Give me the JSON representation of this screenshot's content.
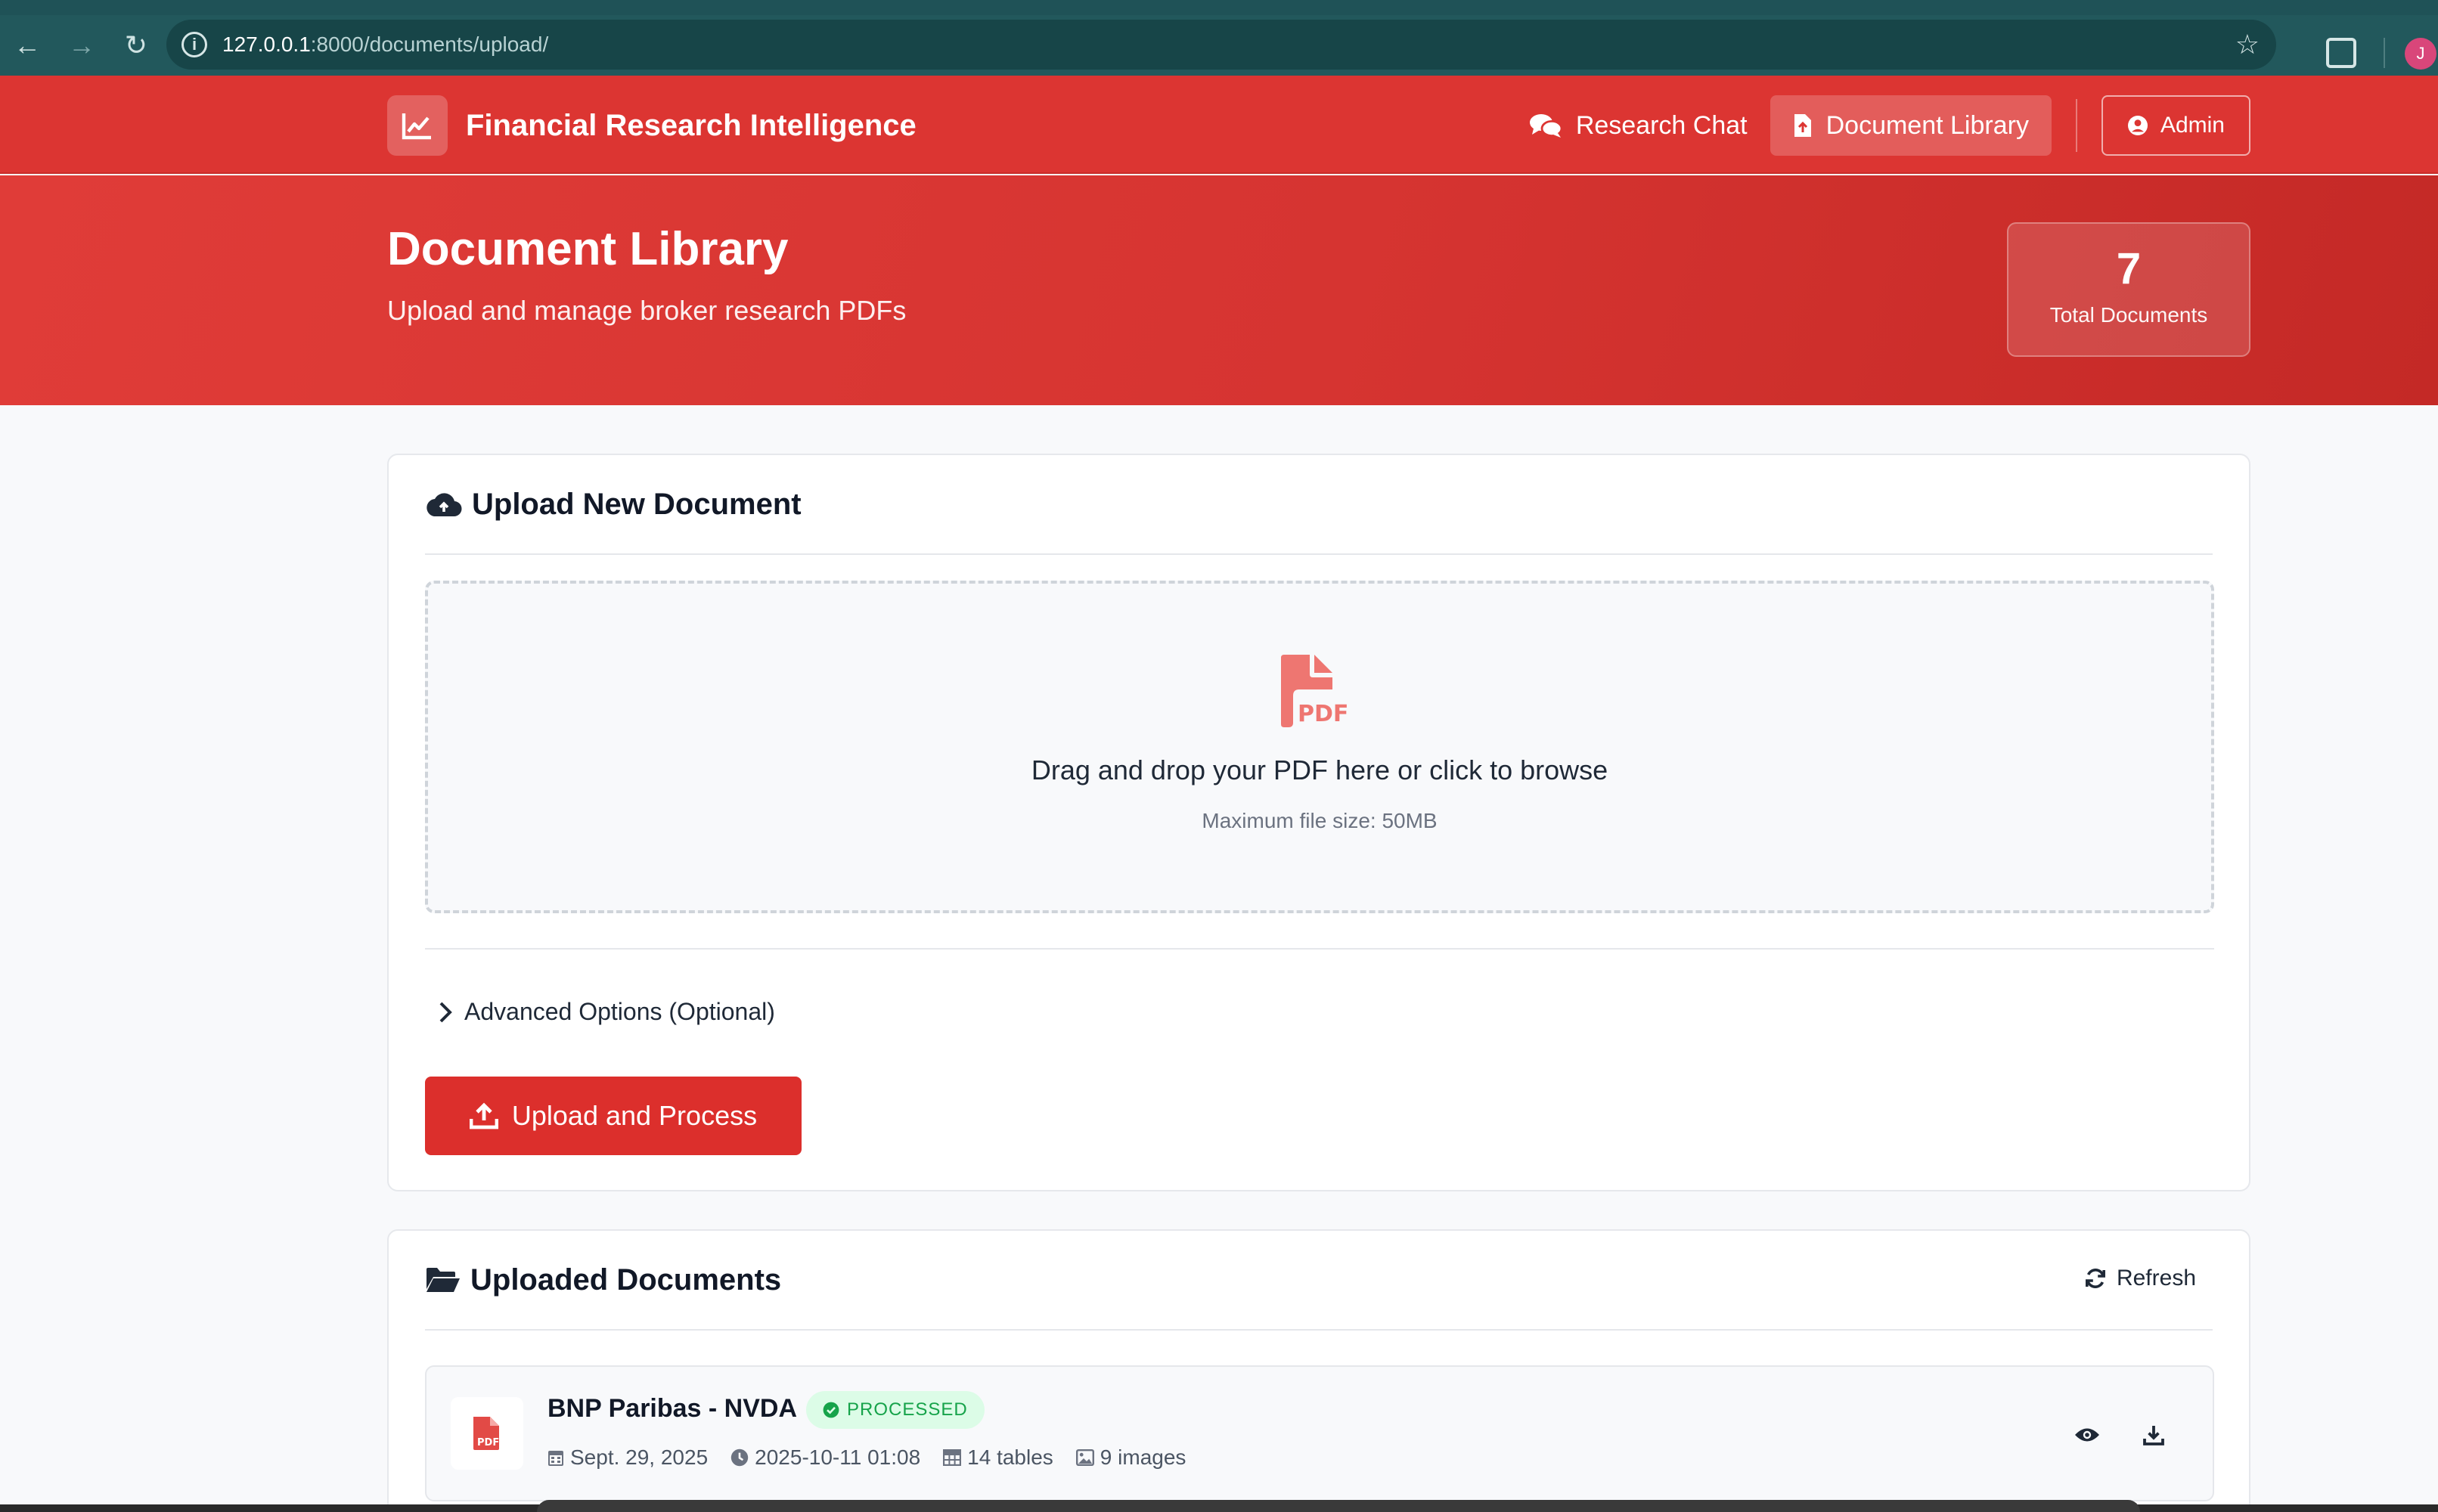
{
  "browser": {
    "url_host": "127.0.0.1",
    "url_path": ":8000/documents/upload/",
    "profile_initial": "J"
  },
  "header": {
    "brand": "Financial Research Intelligence",
    "nav": {
      "research_chat": "Research Chat",
      "document_library": "Document Library",
      "admin": "Admin"
    }
  },
  "hero": {
    "title": "Document Library",
    "subtitle": "Upload and manage broker research PDFs",
    "stat_value": "7",
    "stat_label": "Total Documents"
  },
  "upload": {
    "title": "Upload New Document",
    "drop_title": "Drag and drop your PDF here or click to browse",
    "drop_sub": "Maximum file size: 50MB",
    "advanced": "Advanced Options (Optional)",
    "button": "Upload and Process"
  },
  "docs": {
    "title": "Uploaded Documents",
    "refresh": "Refresh",
    "items": [
      {
        "name": "BNP Paribas - NVDA",
        "status": "PROCESSED",
        "date": "Sept. 29, 2025",
        "processed_at": "2025-10-11 01:08",
        "tables": "14 tables",
        "images": "9 images"
      }
    ]
  },
  "colors": {
    "brand_red": "#dc3532",
    "status_green": "#16a34a",
    "chrome_teal": "#22585c"
  }
}
